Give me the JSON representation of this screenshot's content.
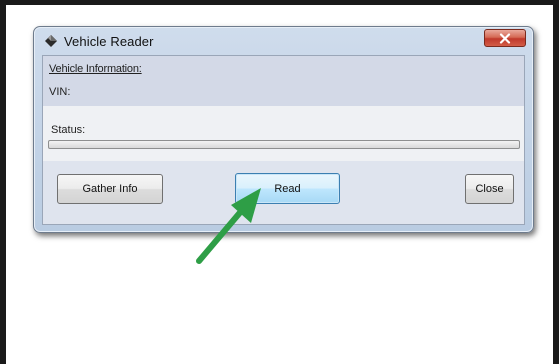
{
  "window": {
    "title": "Vehicle Reader"
  },
  "info": {
    "section_label": "Vehicle Information:",
    "vin_label": "VIN:"
  },
  "status": {
    "label": "Status:",
    "progress_percent": 0
  },
  "buttons": {
    "gather_label": "Gather Info",
    "read_label": "Read",
    "close_label": "Close"
  },
  "annotation": {
    "arrow_color": "#2e9e46",
    "points_to": "Read"
  },
  "colors": {
    "close_button": "#c0392b",
    "read_button_border": "#3c7fb1"
  }
}
